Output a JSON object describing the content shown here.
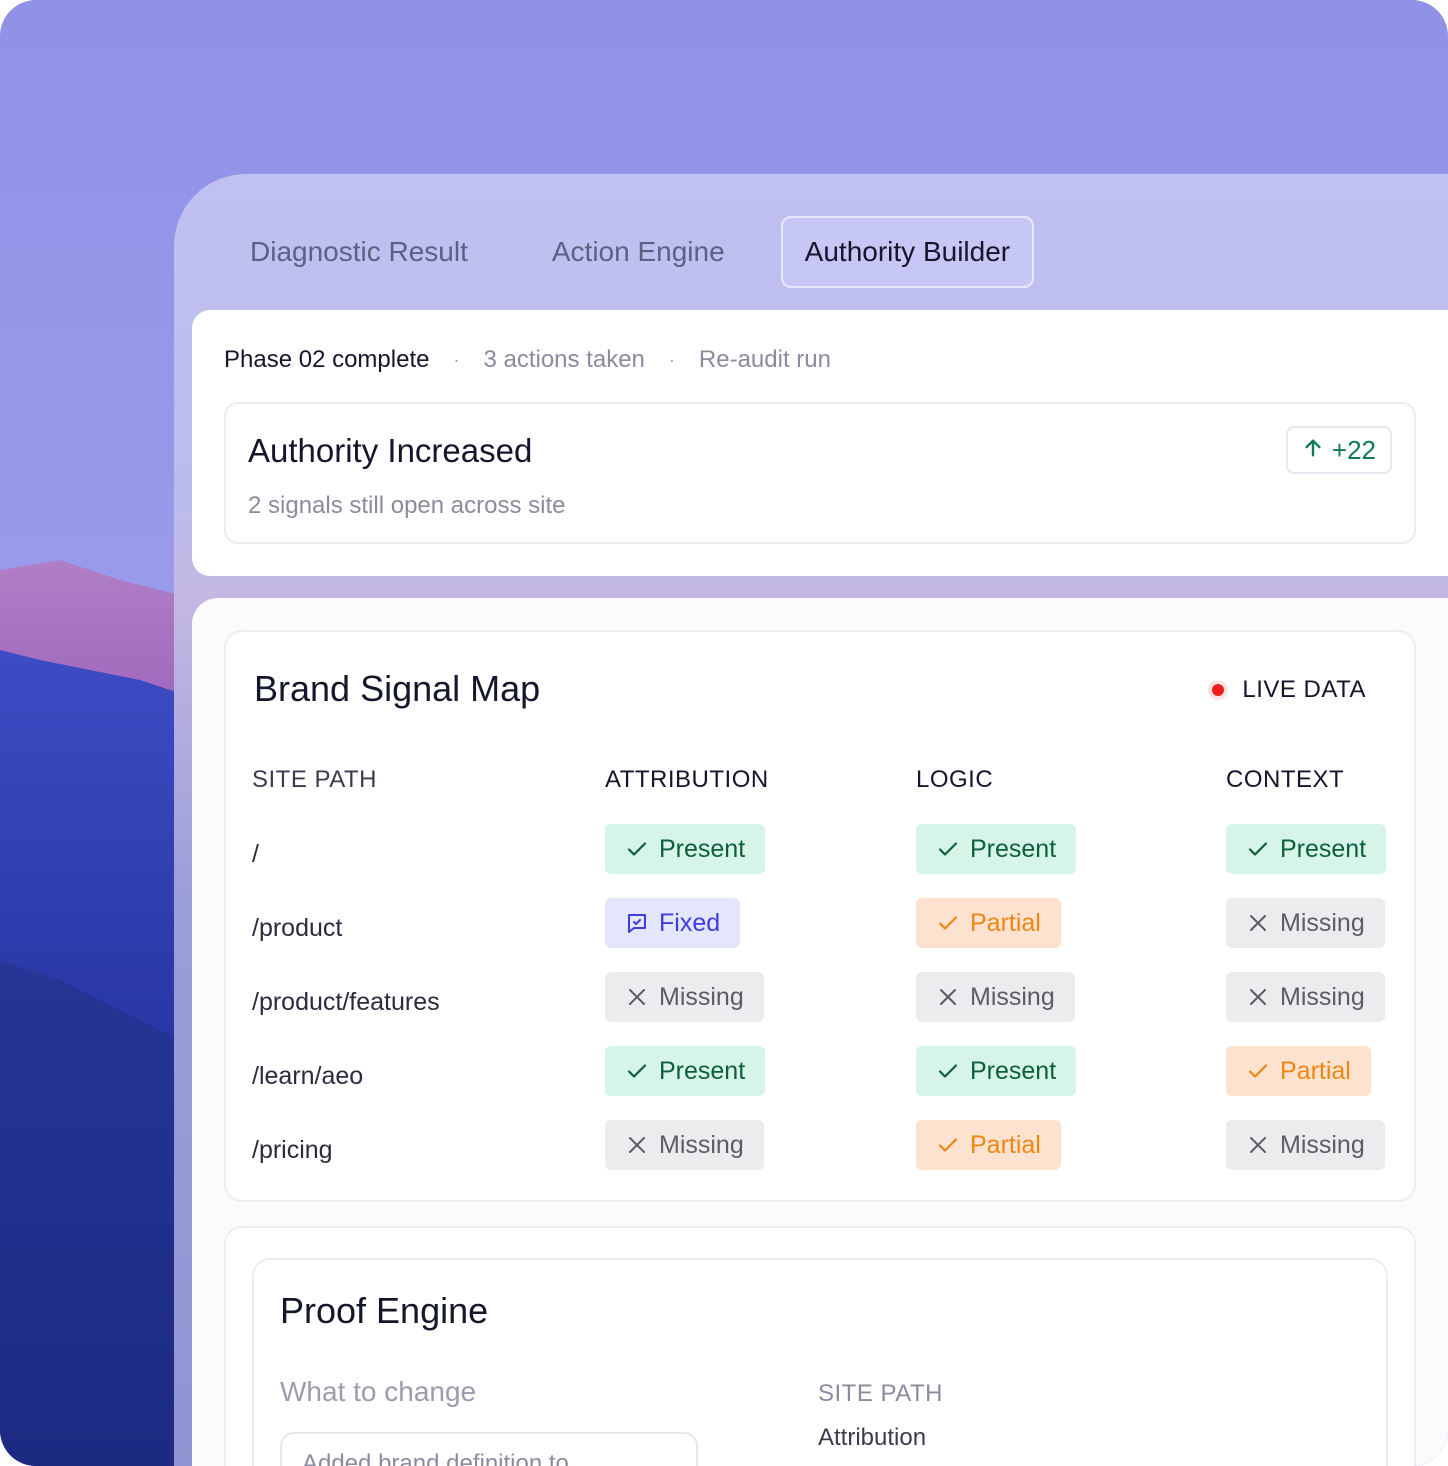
{
  "tabs": [
    {
      "label": "Diagnostic Result"
    },
    {
      "label": "Action Engine"
    },
    {
      "label": "Authority Builder"
    }
  ],
  "status": {
    "phase": "Phase 02 complete",
    "actions": "3 actions taken",
    "reaudit": "Re-audit run",
    "separator": "·"
  },
  "authority": {
    "title": "Authority Increased",
    "subtitle": "2 signals still open across site",
    "delta": "+22"
  },
  "signal_map": {
    "title": "Brand Signal Map",
    "live_label": "LIVE DATA",
    "columns": [
      "SITE PATH",
      "ATTRIBUTION",
      "LOGIC",
      "CONTEXT"
    ],
    "rows": [
      {
        "path": "/",
        "attribution": "Present",
        "logic": "Present",
        "context": "Present"
      },
      {
        "path": "/product",
        "attribution": "Fixed",
        "logic": "Partial",
        "context": "Missing"
      },
      {
        "path": "/product/features",
        "attribution": "Missing",
        "logic": "Missing",
        "context": "Missing"
      },
      {
        "path": "/learn/aeo",
        "attribution": "Present",
        "logic": "Present",
        "context": "Partial"
      },
      {
        "path": "/pricing",
        "attribution": "Missing",
        "logic": "Partial",
        "context": "Missing"
      }
    ]
  },
  "proof_engine": {
    "title": "Proof Engine",
    "what_label": "What to change",
    "site_path_label": "SITE PATH",
    "attribution_label": "Attribution",
    "change_text": "Added brand definition to"
  },
  "colors": {
    "present_bg": "#d6f5e8",
    "present_fg": "#0c5e3f",
    "partial_bg": "#fde3cf",
    "partial_fg": "#ef8614",
    "missing_bg": "#ececee",
    "missing_fg": "#5a5c66",
    "fixed_bg": "#e4e6fe",
    "fixed_fg": "#3e3ce0",
    "live_dot": "#ee1c1c"
  }
}
